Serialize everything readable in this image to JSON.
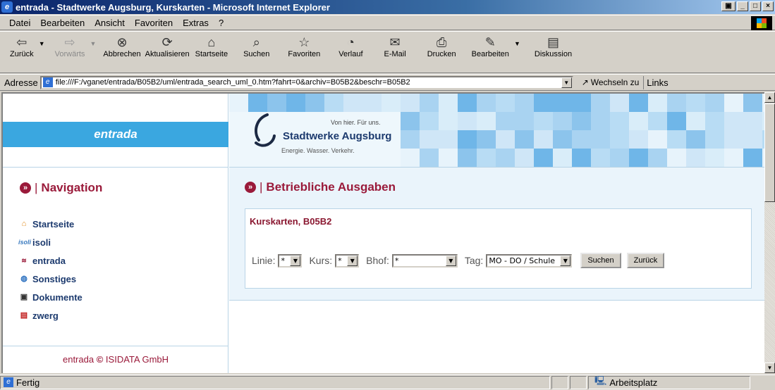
{
  "window": {
    "title": "entrada - Stadtwerke Augsburg, Kurskarten - Microsoft Internet Explorer"
  },
  "menu": [
    "Datei",
    "Bearbeiten",
    "Ansicht",
    "Favoriten",
    "Extras",
    "?"
  ],
  "toolbar": {
    "back": "Zurück",
    "forward": "Vorwärts",
    "stop": "Abbrechen",
    "refresh": "Aktualisieren",
    "home": "Startseite",
    "search": "Suchen",
    "favorites": "Favoriten",
    "history": "Verlauf",
    "mail": "E-Mail",
    "print": "Drucken",
    "edit": "Bearbeiten",
    "discuss": "Diskussion"
  },
  "address": {
    "label": "Adresse",
    "url": "file:///F:/vganet/entrada/B05B2/uml/entrada_search_uml_0.htm?fahrt=0&archiv=B05B2&beschr=B05B2",
    "go": "Wechseln zu",
    "links": "Links"
  },
  "brand": {
    "app": "entrada",
    "claim": "Von hier. Für uns.",
    "company": "Stadtwerke Augsburg",
    "tagline": "Energie. Wasser. Verkehr.",
    "colors": {
      "accent": "#9a1a3a",
      "band": "#3aa7e0",
      "navy": "#1c3a6e"
    }
  },
  "nav": {
    "title": "Navigation",
    "items": [
      {
        "label": "Startseite",
        "icon": "home-icon"
      },
      {
        "label": "isoli",
        "icon": "isoli-icon"
      },
      {
        "label": "entrada",
        "icon": "entrada-icon"
      },
      {
        "label": "Sonstiges",
        "icon": "globe-icon"
      },
      {
        "label": "Dokumente",
        "icon": "document-icon"
      },
      {
        "label": "zwerg",
        "icon": "pdf-icon"
      }
    ],
    "footer_app": "entrada",
    "footer_company": "ISIDATA GmbH"
  },
  "main": {
    "title": "Betriebliche Ausgaben",
    "card_title": "Kurskarten, B05B2",
    "form": {
      "linie_label": "Linie:",
      "linie_value": "*",
      "kurs_label": "Kurs:",
      "kurs_value": "*",
      "bhof_label": "Bhof:",
      "bhof_value": "*",
      "tag_label": "Tag:",
      "tag_value": "MO - DO / Schule",
      "search_button": "Suchen",
      "back_button": "Zurück"
    }
  },
  "status": {
    "text": "Fertig",
    "zone": "Arbeitsplatz"
  }
}
